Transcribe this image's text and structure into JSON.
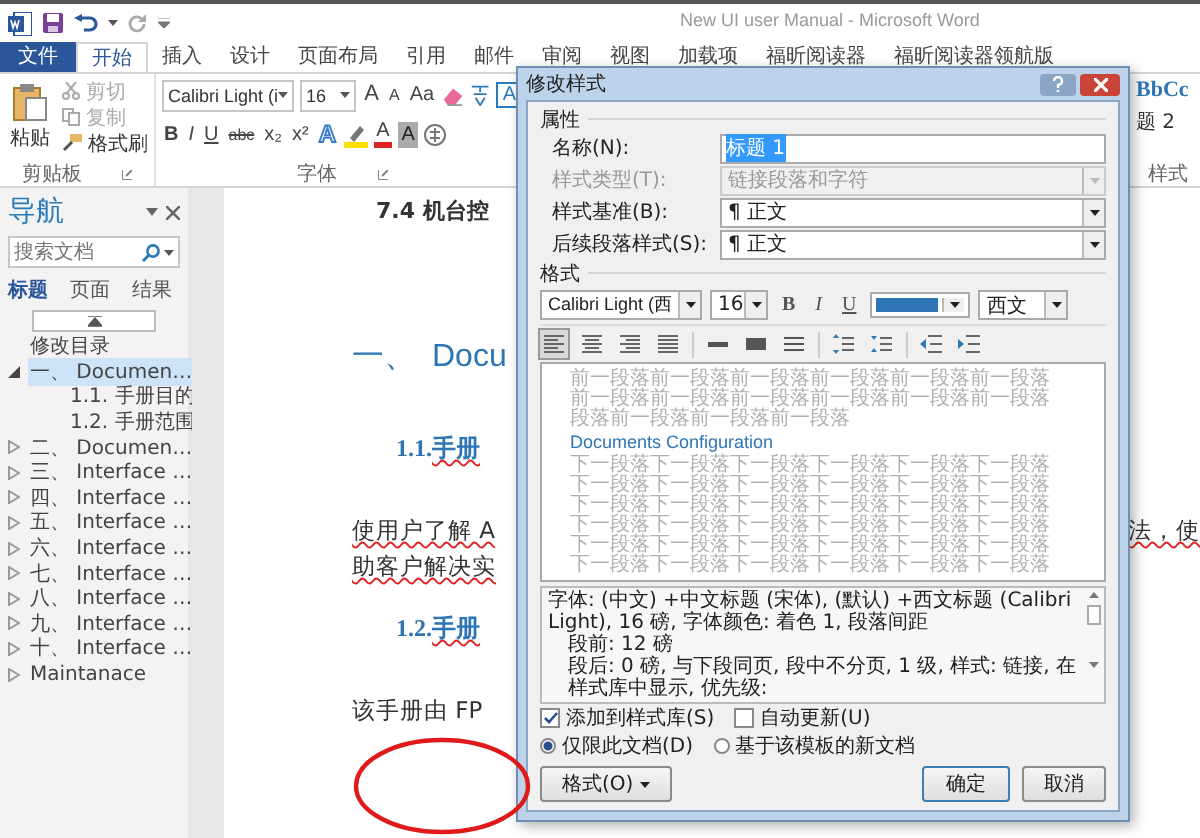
{
  "title_bar": {
    "title": "New UI user Manual - Microsoft Word"
  },
  "ribbon_tabs": [
    {
      "label": "文件",
      "kind": "file",
      "selected": false
    },
    {
      "label": "开始",
      "kind": "tab",
      "selected": true
    },
    {
      "label": "插入",
      "kind": "tab",
      "selected": false
    },
    {
      "label": "设计",
      "kind": "tab",
      "selected": false
    },
    {
      "label": "页面布局",
      "kind": "tab",
      "selected": false
    },
    {
      "label": "引用",
      "kind": "tab",
      "selected": false
    },
    {
      "label": "邮件",
      "kind": "tab",
      "selected": false
    },
    {
      "label": "审阅",
      "kind": "tab",
      "selected": false
    },
    {
      "label": "视图",
      "kind": "tab",
      "selected": false
    },
    {
      "label": "加载项",
      "kind": "tab",
      "selected": false
    },
    {
      "label": "福昕阅读器",
      "kind": "tab",
      "selected": false
    },
    {
      "label": "福昕阅读器领航版",
      "kind": "tab",
      "selected": false
    }
  ],
  "clipboard_group": {
    "paste": "粘贴",
    "items": [
      {
        "label": "剪切",
        "kind": "cut",
        "disabled": true
      },
      {
        "label": "复制",
        "kind": "copy",
        "disabled": true
      },
      {
        "label": "格式刷",
        "kind": "painter",
        "disabled": false
      }
    ],
    "group_label": "剪贴板"
  },
  "font_group": {
    "font": "Calibri Light (i",
    "size": "16",
    "row1_buttons": [
      {
        "kind": "grow",
        "text": "A"
      },
      {
        "kind": "shrink",
        "text": "A"
      },
      {
        "kind": "case",
        "text": "Aa"
      },
      {
        "kind": "clear"
      },
      {
        "kind": "phonetic"
      },
      {
        "kind": "boxed",
        "text": "A"
      }
    ],
    "row2_buttons": [
      {
        "kind": "bold",
        "text": "B"
      },
      {
        "kind": "italic",
        "text": "I"
      },
      {
        "kind": "underline",
        "text": "U"
      },
      {
        "kind": "strike",
        "text": "abc"
      },
      {
        "kind": "sub",
        "text": "x₂"
      },
      {
        "kind": "sup",
        "text": "x²"
      },
      {
        "kind": "effects",
        "text": "A"
      },
      {
        "kind": "highlight"
      },
      {
        "kind": "color",
        "text": "A"
      },
      {
        "kind": "shading",
        "text": "A"
      },
      {
        "kind": "enclose"
      }
    ],
    "group_label": "字体"
  },
  "styles_group": {
    "preview": "BbCc",
    "style_name": "题 2",
    "group_label": "样式"
  },
  "navigation": {
    "title": "导航",
    "search": {
      "placeholder": "搜索文档"
    },
    "tabs": [
      {
        "label": "标题",
        "selected": true
      },
      {
        "label": "页面",
        "selected": false
      },
      {
        "label": "结果",
        "selected": false
      }
    ],
    "tree": [
      {
        "label": "修改目录",
        "selected": false
      },
      {
        "label": "一、 Documen…",
        "expanded": true,
        "selected": true,
        "children": [
          {
            "label": "1.1. 手册目的",
            "selected": false
          },
          {
            "label": "1.2. 手册范围",
            "selected": false
          }
        ]
      },
      {
        "label": "二、 Documen…",
        "expanded": false,
        "selected": false
      },
      {
        "label": "三、 Interface …",
        "expanded": false,
        "selected": false
      },
      {
        "label": "四、 Interface …",
        "expanded": false,
        "selected": false
      },
      {
        "label": "五、 Interface …",
        "expanded": false,
        "selected": false
      },
      {
        "label": "六、 Interface …",
        "expanded": false,
        "selected": false
      },
      {
        "label": "七、 Interface …",
        "expanded": false,
        "selected": false
      },
      {
        "label": "八、 Interface …",
        "expanded": false,
        "selected": false
      },
      {
        "label": "九、 Interface …",
        "expanded": false,
        "selected": false
      },
      {
        "label": "十、 Interface …",
        "expanded": false,
        "selected": false
      },
      {
        "label": "Maintanace",
        "expanded": false,
        "selected": false
      }
    ]
  },
  "document": {
    "lines": [
      {
        "kind": "header",
        "text": "7.4 机台控"
      },
      {
        "kind": "heading1",
        "number": "一、",
        "text": "Docu"
      },
      {
        "kind": "heading2",
        "number": "1.1.",
        "text": "手册",
        "flagged": true
      },
      {
        "kind": "body",
        "text": "使用户了解 A",
        "tail": "法，使",
        "flagged": true
      },
      {
        "kind": "body",
        "text": "助客户解决实",
        "flagged": true
      },
      {
        "kind": "heading2",
        "number": "1.2.",
        "text": "手册",
        "flagged": true
      },
      {
        "kind": "body",
        "text": "该手册由 FP",
        "flagged": false
      }
    ]
  },
  "dialog": {
    "title": "修改样式",
    "properties_label": "属性",
    "fields": [
      {
        "label": "名称(N):",
        "kind": "text",
        "value": "标题 1",
        "text_selected": true,
        "disabled": false
      },
      {
        "label": "样式类型(T):",
        "kind": "dropdown",
        "value": "链接段落和字符",
        "disabled": true
      },
      {
        "label": "样式基准(B):",
        "kind": "dropdown",
        "value": "¶ 正文",
        "disabled": false
      },
      {
        "label": "后续段落样式(S):",
        "kind": "dropdown",
        "value": "¶ 正文",
        "disabled": false
      }
    ],
    "format_label": "格式",
    "font": "Calibri Light (西",
    "size": "16",
    "style_buttons": [
      {
        "kind": "bold",
        "text": "B"
      },
      {
        "kind": "italic",
        "text": "I"
      },
      {
        "kind": "underline",
        "text": "U"
      }
    ],
    "script": "西文",
    "align_buttons": [
      {
        "kind": "align-left",
        "selected": true
      },
      {
        "kind": "align-center",
        "selected": false
      },
      {
        "kind": "align-right",
        "selected": false
      },
      {
        "kind": "justify",
        "selected": false
      },
      {
        "kind": "single-spacing",
        "selected": false
      },
      {
        "kind": "one-half-spacing",
        "selected": false
      },
      {
        "kind": "double-spacing",
        "selected": false
      },
      {
        "kind": "space-increase",
        "selected": false
      },
      {
        "kind": "space-decrease",
        "selected": false
      },
      {
        "kind": "indent-decrease",
        "selected": false
      },
      {
        "kind": "indent-increase",
        "selected": false
      }
    ],
    "preview": {
      "before": [
        "前一段落前一段落前一段落前一段落前一段落前一段落",
        "前一段落前一段落前一段落前一段落前一段落前一段落",
        "段落前一段落前一段落前一段落"
      ],
      "heading": "Documents Configuration",
      "after": [
        "下一段落下一段落下一段落下一段落下一段落下一段落",
        "下一段落下一段落下一段落下一段落下一段落下一段落",
        "下一段落下一段落下一段落下一段落下一段落下一段落",
        "下一段落下一段落下一段落下一段落下一段落下一段落",
        "下一段落下一段落下一段落下一段落下一段落下一段落",
        "下一段落下一段落下一段落下一段落下一段落下一段落"
      ]
    },
    "description": [
      "字体: (中文) +中文标题 (宋体), (默认) +西文标题 (Calibri Light), 16 磅, 字体颜色: 着色 1, 段落间距",
      "段前: 12 磅",
      "段后: 0 磅, 与下段同页, 段中不分页, 1 级, 样式: 链接, 在样式库中显示, 优先级:"
    ],
    "checkboxes": [
      {
        "label": "添加到样式库(S)",
        "checked": true
      },
      {
        "label": "自动更新(U)",
        "checked": false
      }
    ],
    "radios": [
      {
        "label": "仅限此文档(D)",
        "selected": true
      },
      {
        "label": "基于该模板的新文档",
        "selected": false
      }
    ],
    "format_button": "格式(O)",
    "ok": "确定",
    "cancel": "取消"
  }
}
